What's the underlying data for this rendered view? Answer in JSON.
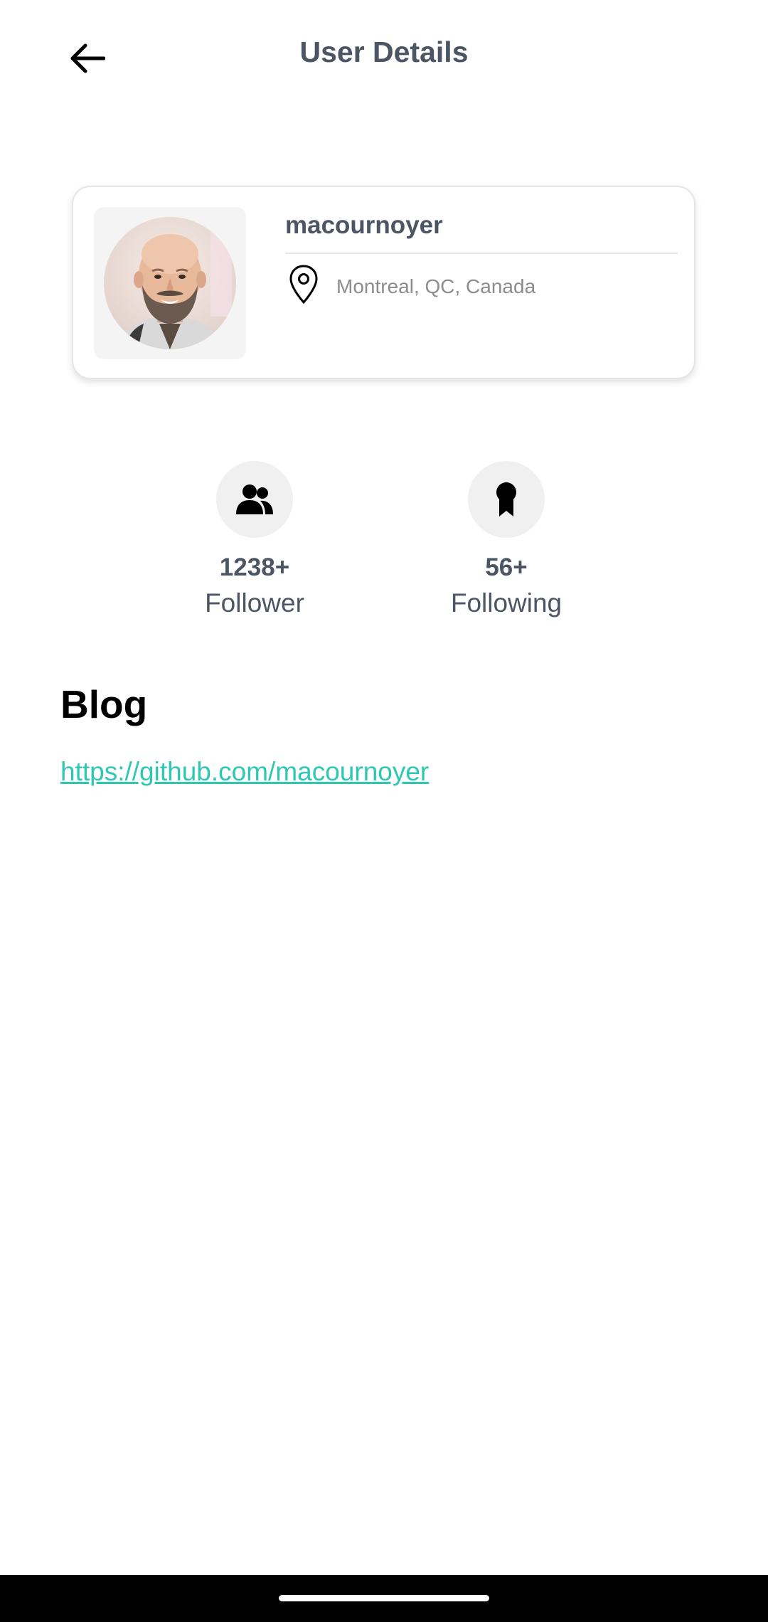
{
  "header": {
    "title": "User Details",
    "back_icon": "arrow-left-icon"
  },
  "profile": {
    "username": "macournoyer",
    "location": "Montreal, QC, Canada",
    "location_icon": "map-pin-icon"
  },
  "stats": {
    "followers": {
      "count": "1238+",
      "label": "Follower",
      "icon": "people-icon"
    },
    "following": {
      "count": "56+",
      "label": "Following",
      "icon": "award-ribbon-icon"
    }
  },
  "blog": {
    "heading": "Blog",
    "url": "https://github.com/macournoyer"
  },
  "colors": {
    "link": "#2ec7b2",
    "text_primary": "#4b5563",
    "card_border": "#e6e6e6",
    "icon_circle_bg": "#f0f0f0"
  }
}
